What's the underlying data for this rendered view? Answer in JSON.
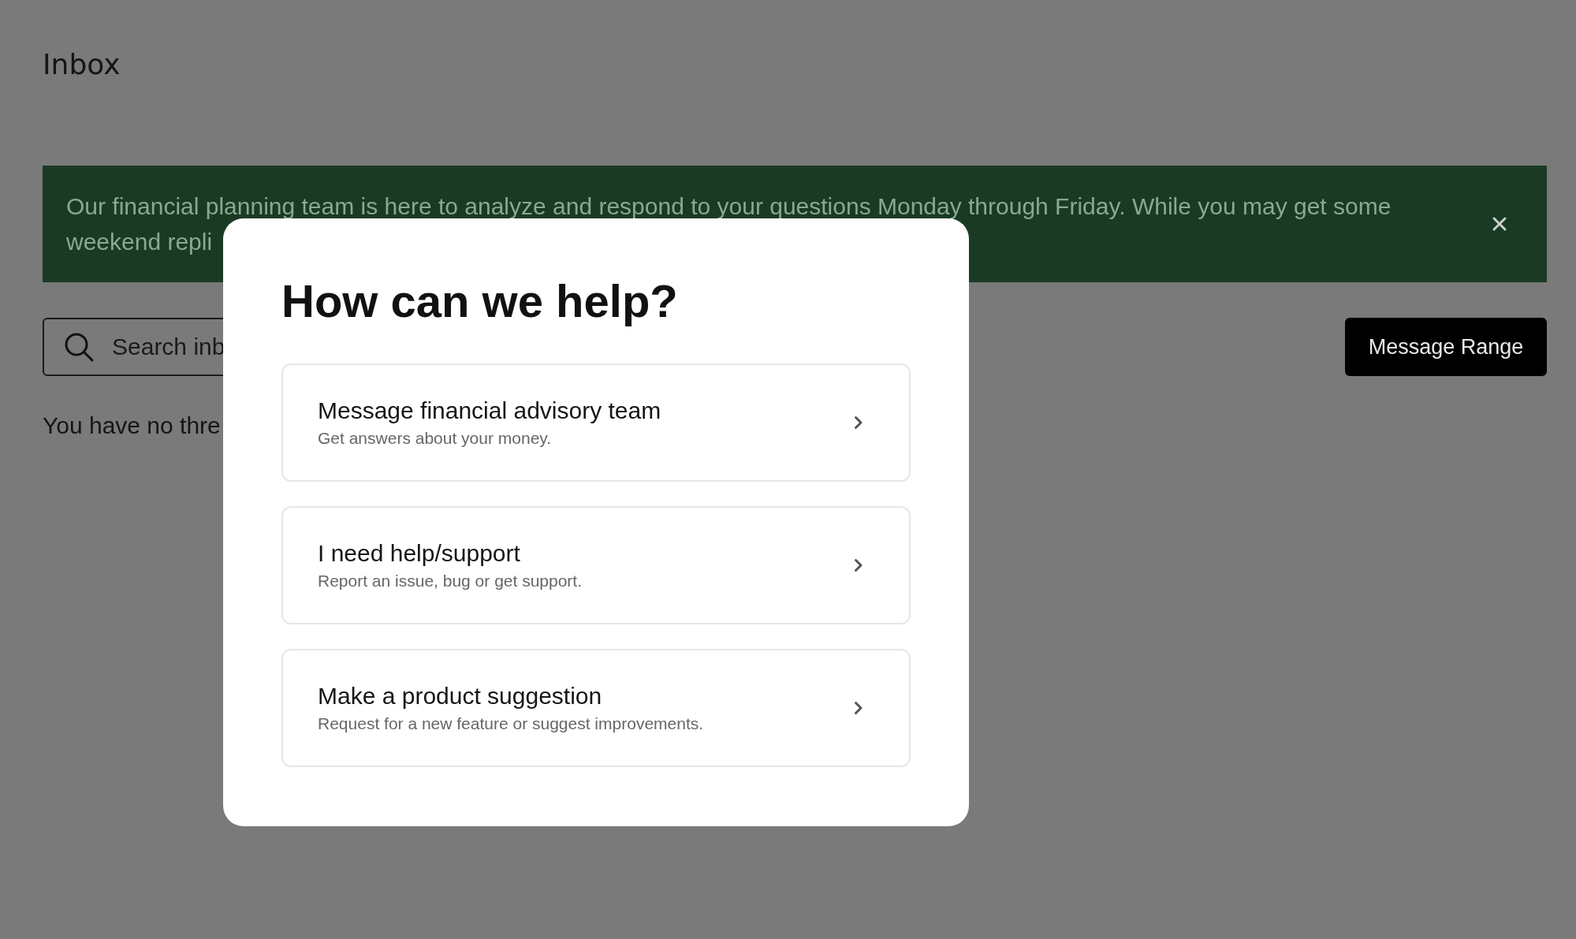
{
  "page": {
    "title": "Inbox"
  },
  "banner": {
    "lines": [
      "Our financial planning team is here to analyze and respond to your questions Monday through Friday. While you may get some",
      "weekend repli"
    ]
  },
  "search": {
    "placeholder": "Search inb"
  },
  "message_range_button": {
    "label": "Message Range"
  },
  "empty_state": {
    "text": "You have no thre"
  },
  "modal": {
    "title": "How can we help?",
    "options": [
      {
        "title": "Message financial advisory team",
        "description": "Get answers about your money."
      },
      {
        "title": "I need help/support",
        "description": "Report an issue, bug or get support."
      },
      {
        "title": "Make a product suggestion",
        "description": "Request for a new feature or suggest improvements."
      }
    ]
  }
}
